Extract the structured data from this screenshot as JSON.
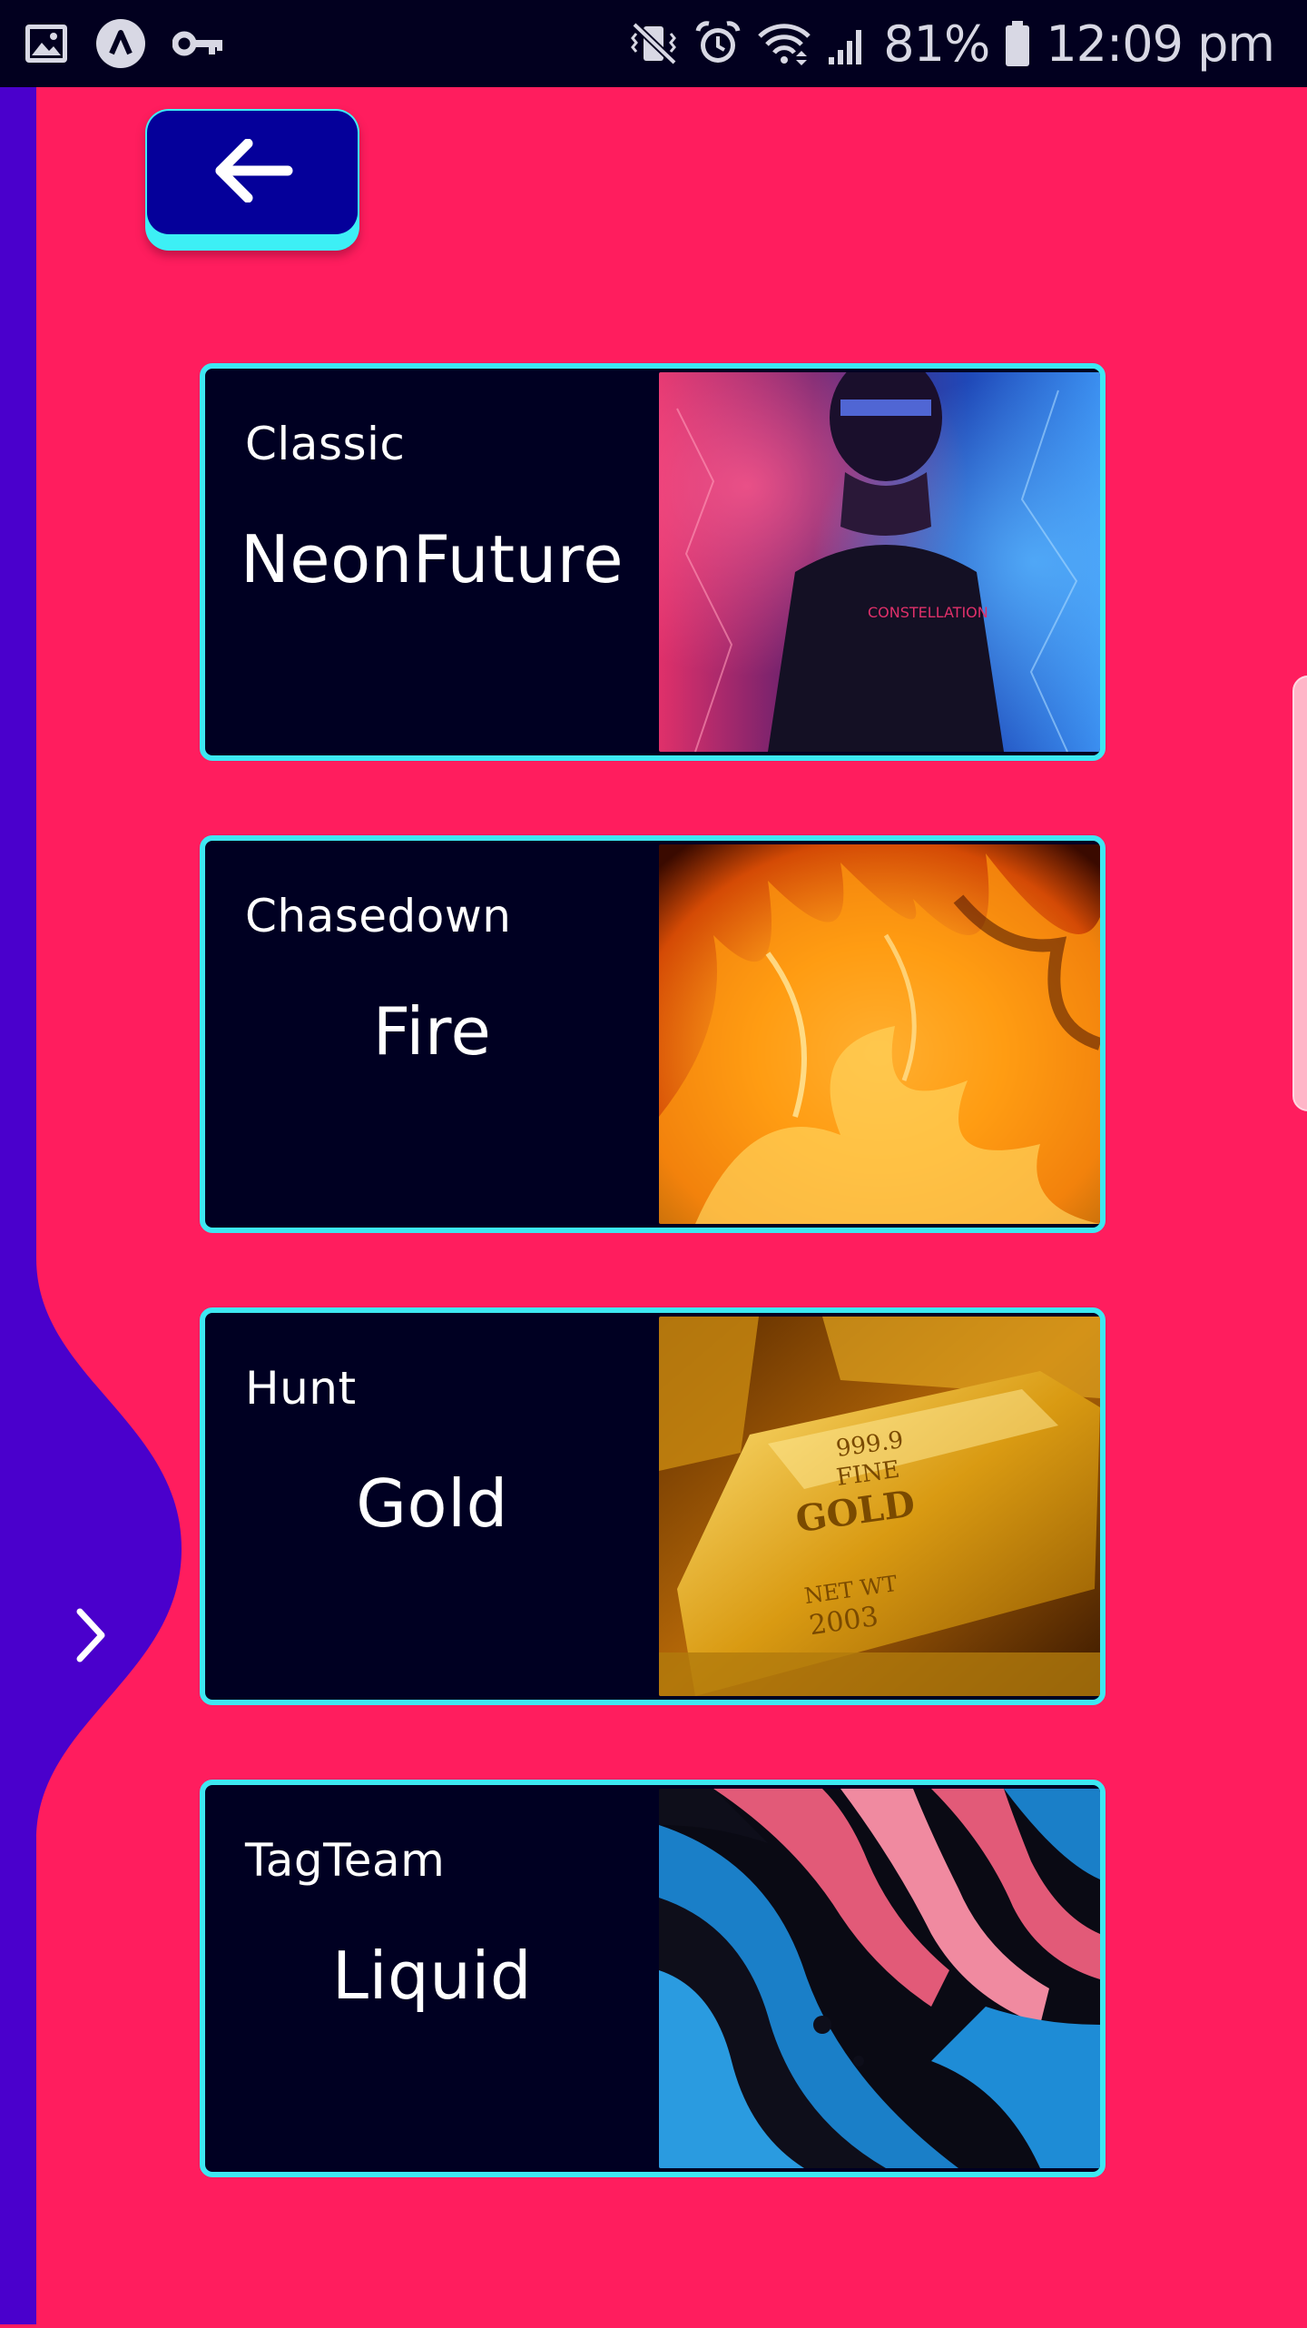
{
  "status_bar": {
    "battery_percent": "81%",
    "time": "12:09 pm",
    "icons_left": [
      "gallery-icon",
      "app-a-icon",
      "key-icon"
    ],
    "icons_right": [
      "vibrate-mute-icon",
      "alarm-icon",
      "wifi-icon",
      "signal-icon",
      "battery-icon"
    ]
  },
  "colors": {
    "background": "#FF1D5E",
    "sidebar": "#4A00CC",
    "card_border": "#3DE8F2",
    "card_fill": "#000022",
    "back_button": "#05009A",
    "status_bar": "#02001F"
  },
  "back_button": {
    "icon": "arrow-left-icon"
  },
  "sidebar": {
    "toggle_icon": "chevron-right-icon"
  },
  "cards": [
    {
      "mode": "Classic",
      "theme": "NeonFuture",
      "image": "neon-portrait-image"
    },
    {
      "mode": "Chasedown",
      "theme": "Fire",
      "image": "fire-flames-image"
    },
    {
      "mode": "Hunt",
      "theme": "Gold",
      "image": "gold-bars-image"
    },
    {
      "mode": "TagTeam",
      "theme": "Liquid",
      "image": "liquid-paint-image"
    }
  ]
}
